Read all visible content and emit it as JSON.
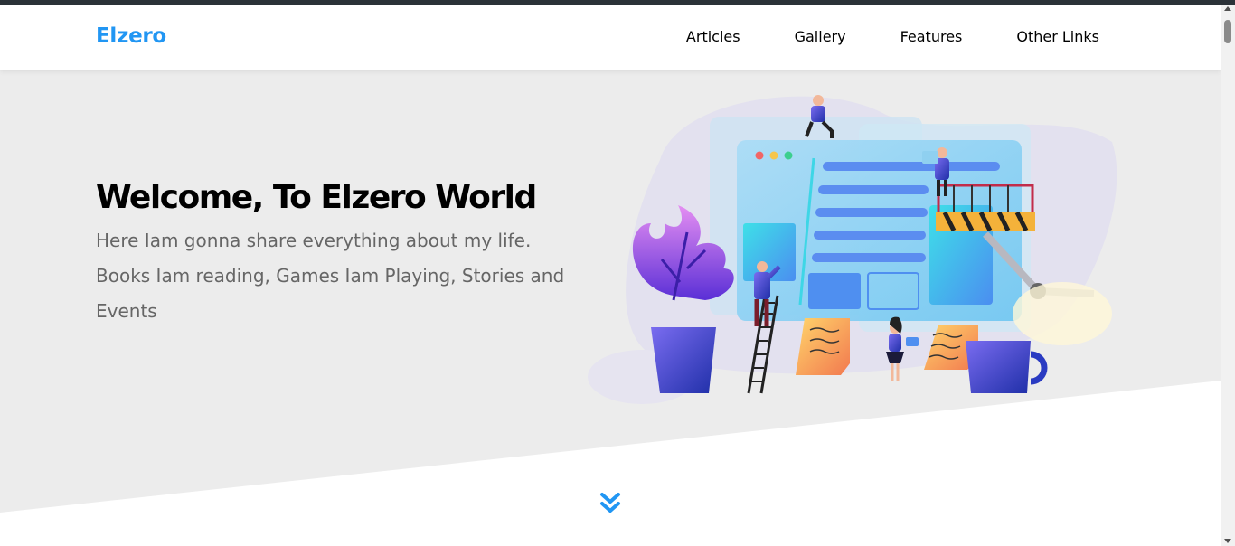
{
  "header": {
    "logo": "Elzero",
    "nav": [
      {
        "label": "Articles"
      },
      {
        "label": "Gallery"
      },
      {
        "label": "Features"
      },
      {
        "label": "Other Links"
      }
    ]
  },
  "landing": {
    "title": "Welcome, To Elzero World",
    "description": "Here Iam gonna share everything about my life. Books Iam reading, Games Iam Playing, Stories and Events"
  },
  "icons": {
    "scroll_down": "double-chevron-down-icon",
    "illustration": "web-design-team-illustration"
  },
  "colors": {
    "brand": "#2196f3",
    "landing_bg": "#ececec"
  }
}
